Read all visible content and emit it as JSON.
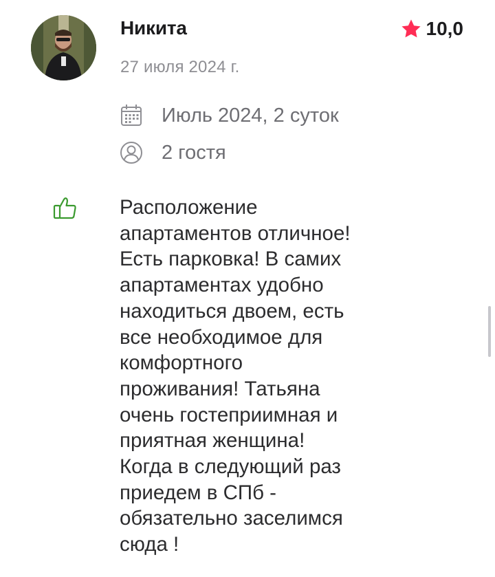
{
  "review": {
    "author": {
      "name": "Никита",
      "avatar_icon": "user-photo-avatar"
    },
    "date": "27 июля 2024 г.",
    "rating": {
      "value": "10,0",
      "icon": "star-icon",
      "color": "#ff2d55"
    },
    "stay": {
      "icon": "calendar-icon",
      "text": "Июль 2024, 2 суток"
    },
    "guests": {
      "icon": "user-circle-icon",
      "text": "2 гостя"
    },
    "positive": {
      "icon": "thumbs-up-icon",
      "color": "#3a9a2e",
      "text": "Расположение\nапартаментов отличное!\nЕсть парковка! В самих\nапартаментах удобно\nнаходиться двоем, есть\nвсе необходимое для\nкомфортного\nпроживания! Татьяна\nочень гостеприимная и\nприятная женщина!\nКогда в следующий раз\nприедем в СПб -\nобязательно заселимся\nсюда !"
    }
  }
}
